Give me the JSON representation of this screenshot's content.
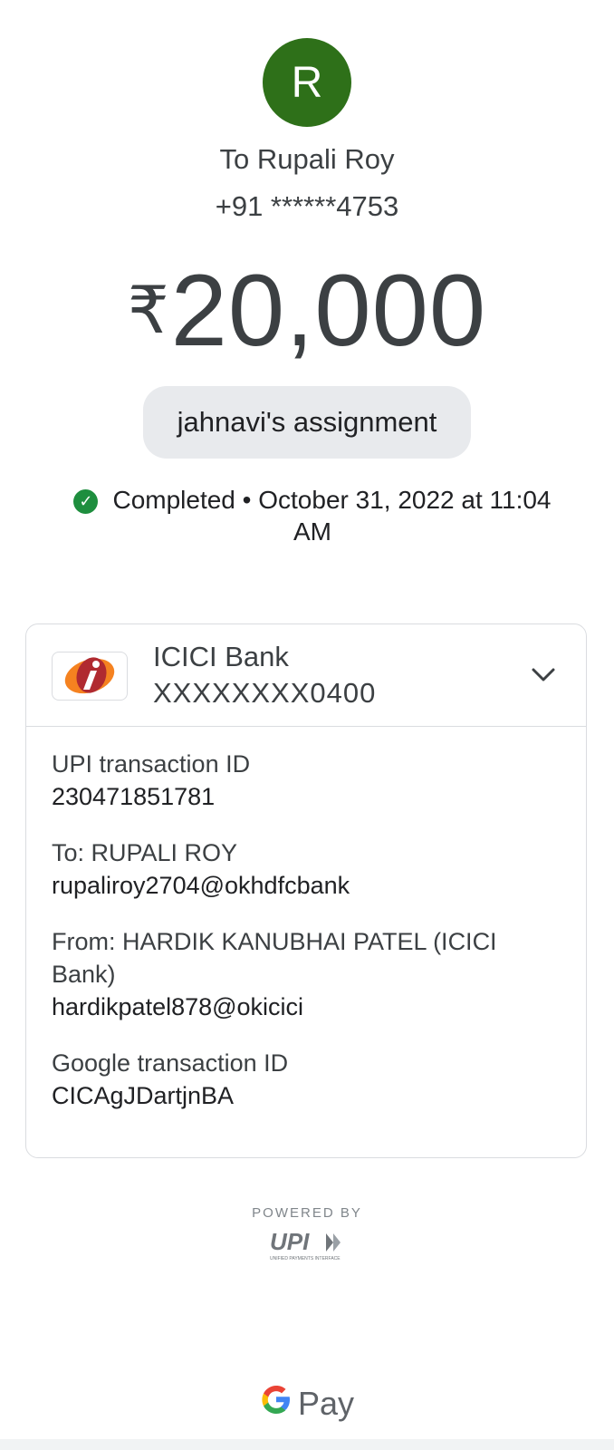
{
  "recipient": {
    "avatar_initial": "R",
    "avatar_color": "#2e7019",
    "name_line": "To Rupali Roy",
    "phone": "+91 ******4753"
  },
  "payment": {
    "currency_symbol": "₹",
    "amount": "20,000",
    "note": "jahnavi's assignment",
    "status_text": "Completed • October 31, 2022 at 11:04 AM",
    "status_color": "#1e8e3e"
  },
  "bank": {
    "name": "ICICI Bank",
    "account": "XXXXXXXX0400",
    "logo_letter": "i"
  },
  "details": [
    {
      "label": "UPI transaction ID",
      "value": "230471851781"
    },
    {
      "label": "To: RUPALI ROY",
      "value": "rupaliroy2704@okhdfcbank"
    },
    {
      "label": "From: HARDIK KANUBHAI PATEL (ICICI Bank)",
      "value": "hardikpatel878@okicici"
    },
    {
      "label": "Google transaction ID",
      "value": "CICAgJDartjnBA"
    }
  ],
  "footer": {
    "powered_by": "POWERED BY",
    "upi_logo_text": "UPI",
    "upi_tagline": "UNIFIED PAYMENTS INTERFACE",
    "brand_g": "G",
    "brand_pay": "Pay"
  }
}
